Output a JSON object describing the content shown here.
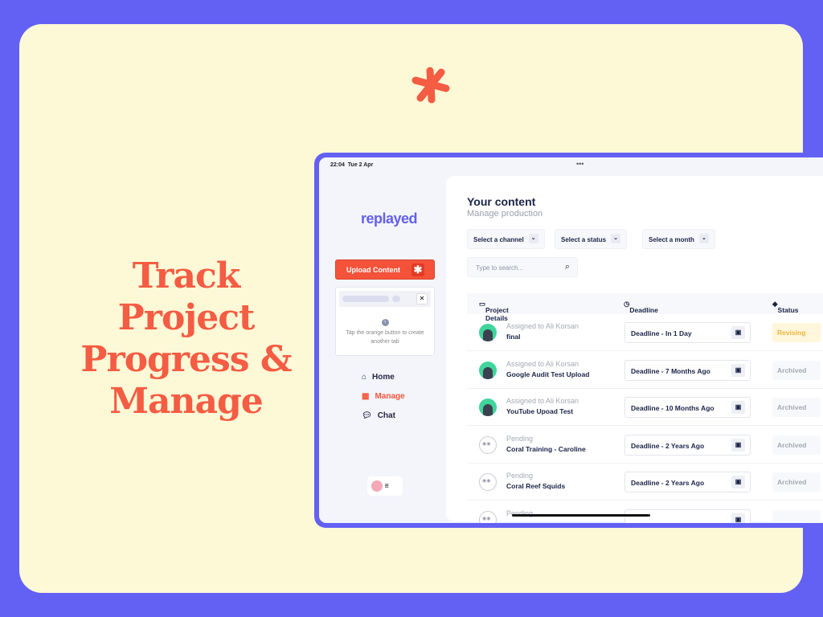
{
  "headline": [
    "Track",
    "Project",
    "Progress &",
    "Manage"
  ],
  "colors": {
    "accent": "#f4533a",
    "brand": "#6461e8",
    "background": "#fdf8d6",
    "frame": "#6360f4"
  },
  "status_bar": {
    "time": "22:04",
    "date": "Tue 2 Apr"
  },
  "sidebar": {
    "logo": "replayed",
    "upload_label": "Upload Content",
    "tip": "Tap the orange button to create another tab",
    "items": [
      {
        "label": "Home",
        "icon": "home-icon"
      },
      {
        "label": "Manage",
        "icon": "grid-icon",
        "active": true
      },
      {
        "label": "Chat",
        "icon": "chat-icon"
      }
    ]
  },
  "main": {
    "title": "Your content",
    "subtitle": "Manage production",
    "filters": [
      "Select a channel",
      "Select a status",
      "Select a month"
    ],
    "search_placeholder": "Type to search...",
    "columns": [
      "Project Details",
      "Deadline",
      "Status"
    ],
    "rows": [
      {
        "assignee": "Assigned to Ali Korsan",
        "project": "final",
        "deadline": "Deadline - In 1 Day",
        "status": "Revising",
        "avatar": "ali"
      },
      {
        "assignee": "Assigned to Ali Korsan",
        "project": "Google Audit Test Upload",
        "deadline": "Deadline - 7 Months Ago",
        "status": "Archived",
        "avatar": "ali"
      },
      {
        "assignee": "Assigned to Ali Korsan",
        "project": "YouTube Upoad Test",
        "deadline": "Deadline - 10 Months Ago",
        "status": "Archived",
        "avatar": "ali"
      },
      {
        "assignee": "Pending",
        "project": "Coral Training - Caroline",
        "deadline": "Deadline - 2 Years Ago",
        "status": "Archived",
        "avatar": "pending"
      },
      {
        "assignee": "Pending",
        "project": "Coral Reef Squids",
        "deadline": "Deadline - 2 Years Ago",
        "status": "Archived",
        "avatar": "pending"
      },
      {
        "assignee": "Pending",
        "project": "",
        "deadline": "",
        "status": "",
        "avatar": "pending"
      }
    ]
  }
}
